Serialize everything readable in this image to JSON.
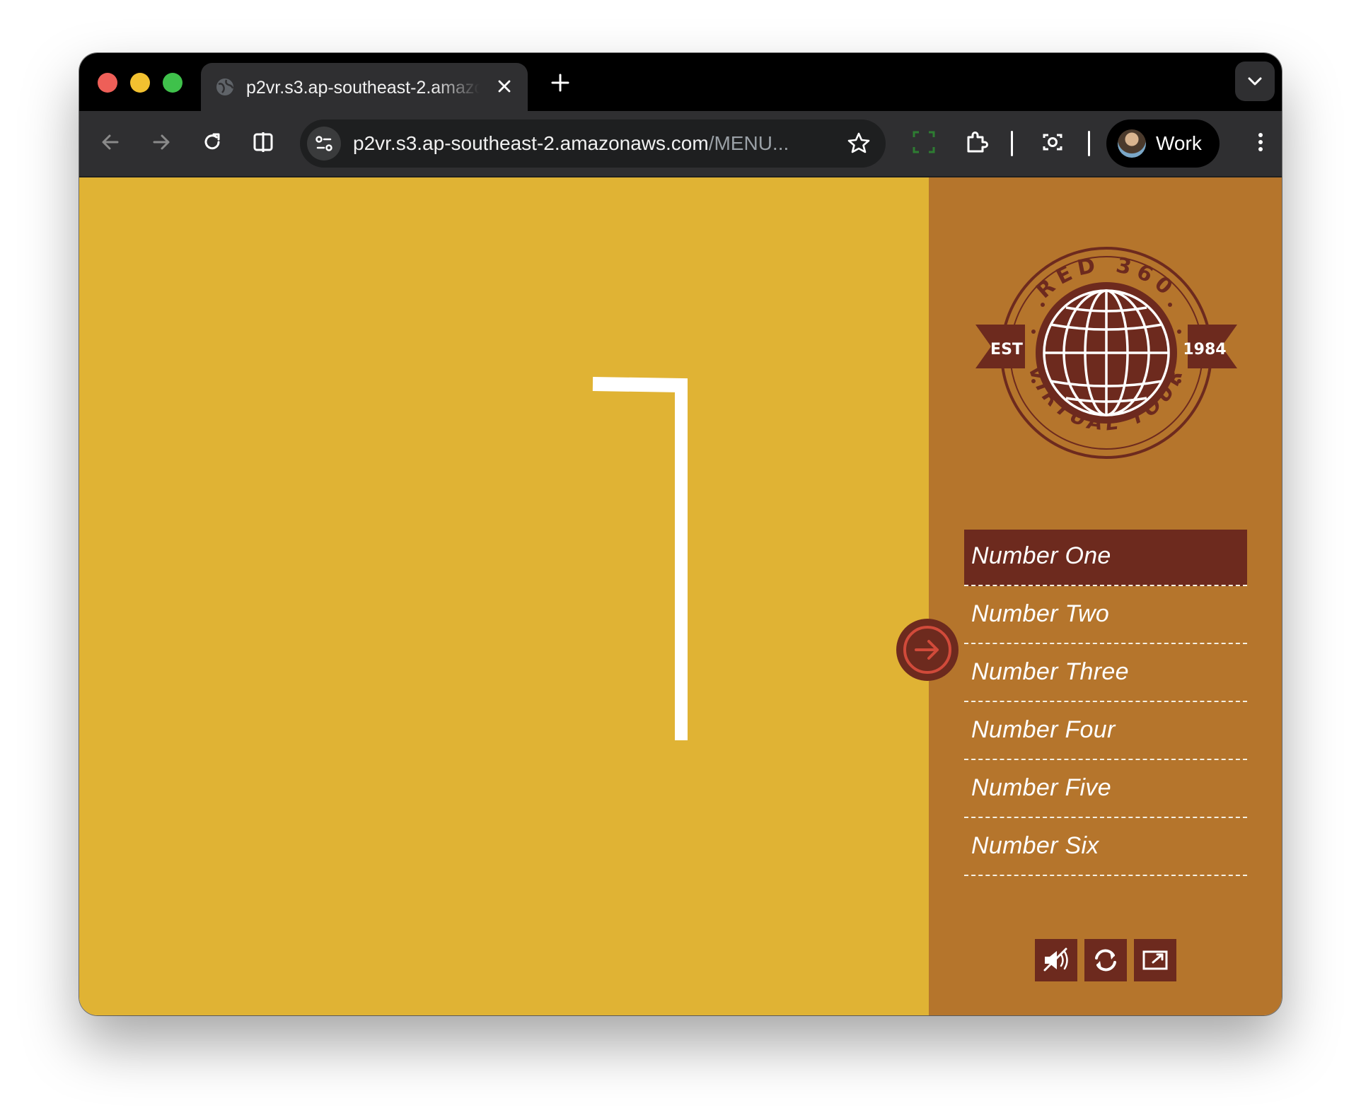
{
  "browser": {
    "tab_title": "p2vr.s3.ap-southeast-2.amazonaws.com",
    "url_domain": "p2vr.s3.ap-southeast-2.amazonaws.com",
    "url_path": "/MENU...",
    "profile_label": "Work"
  },
  "stage": {
    "background": "#e0b334",
    "numeral": "1"
  },
  "sidebar": {
    "background": "#b5752c",
    "accent": "#6d2a1e",
    "logo": {
      "top_text": "RED 360",
      "bottom_text": "VIRTUAL TOUR",
      "left_text": "EST",
      "right_text": "1984"
    },
    "menu": [
      {
        "label": "Number One",
        "active": true
      },
      {
        "label": "Number Two",
        "active": false
      },
      {
        "label": "Number Three",
        "active": false
      },
      {
        "label": "Number Four",
        "active": false
      },
      {
        "label": "Number Five",
        "active": false
      },
      {
        "label": "Number Six",
        "active": false
      }
    ],
    "controls": [
      "mute-icon",
      "rotate-icon",
      "fullscreen-icon"
    ]
  }
}
